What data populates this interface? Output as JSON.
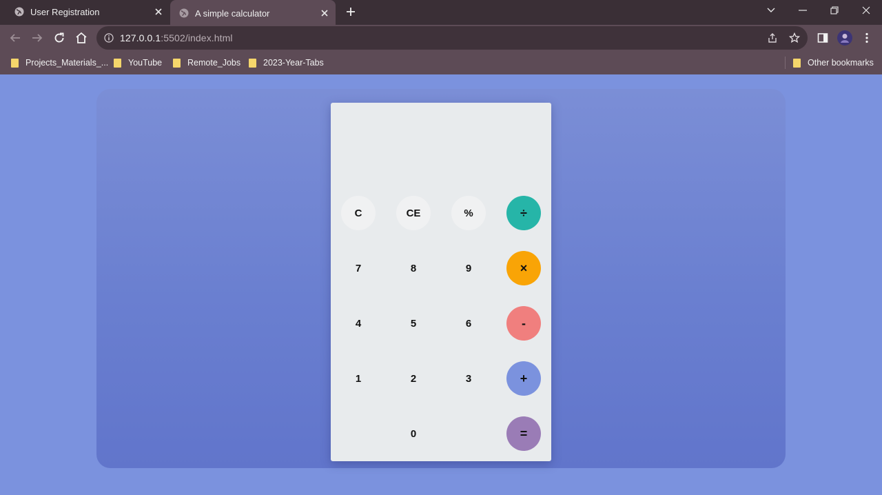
{
  "browser": {
    "tabs": [
      {
        "title": "User Registration",
        "active": false
      },
      {
        "title": "A simple calculator",
        "active": true
      }
    ],
    "url_host": "127.0.0.1",
    "url_rest": ":5502/index.html",
    "bookmarks": [
      "Projects_Materials_...",
      "YouTube",
      "Remote_Jobs",
      "2023-Year-Tabs"
    ],
    "other_bookmarks": "Other bookmarks"
  },
  "calculator": {
    "display": "",
    "keys": {
      "clear": "C",
      "clear_entry": "CE",
      "percent": "%",
      "divide": "÷",
      "seven": "7",
      "eight": "8",
      "nine": "9",
      "multiply": "×",
      "four": "4",
      "five": "5",
      "six": "6",
      "minus": "-",
      "one": "1",
      "two": "2",
      "three": "3",
      "plus": "+",
      "zero": "0",
      "equals": "="
    },
    "colors": {
      "divide": "#26b5a8",
      "multiply": "#f9a406",
      "minus": "#f07f7e",
      "plus": "#7b92de",
      "equals": "#9a7cb6"
    }
  }
}
